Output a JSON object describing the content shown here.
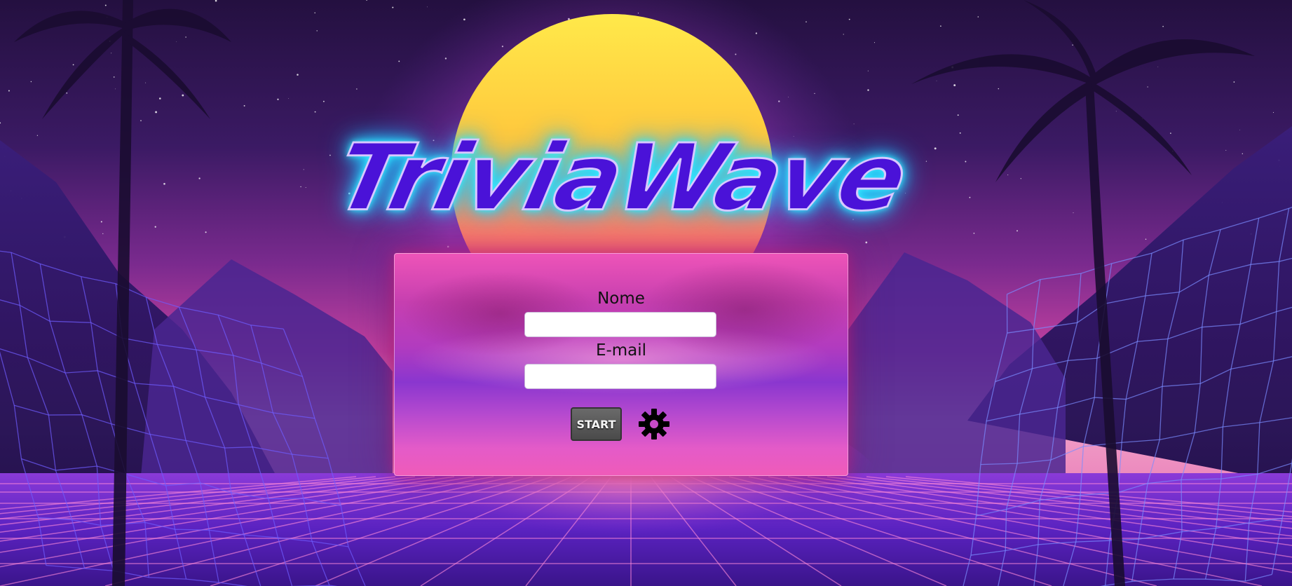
{
  "app": {
    "logo_text": "TriviaWave"
  },
  "form": {
    "name_label": "Nome",
    "name_value": "",
    "email_label": "E-mail",
    "email_value": "",
    "start_label": "START"
  },
  "icons": {
    "settings": "gear-icon"
  },
  "colors": {
    "sky_top": "#2a1350",
    "sky_horizon": "#e04aa0",
    "sun_top": "#ffe94a",
    "sun_bottom": "#ff3db0",
    "grid_line": "#6f5cff",
    "logo_fill": "#4a12d8",
    "logo_glow": "#2ee6ff",
    "button_bg": "#555555"
  }
}
